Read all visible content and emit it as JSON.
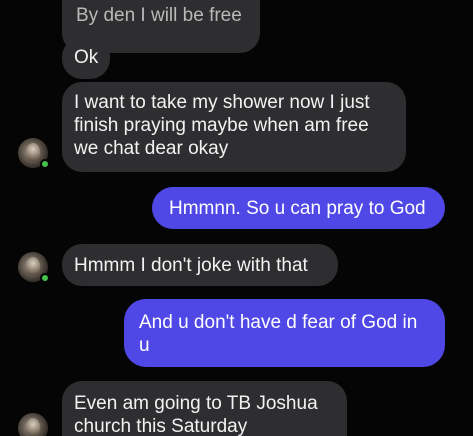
{
  "messages": [
    {
      "side": "received",
      "text": "By den I will be free"
    },
    {
      "side": "received",
      "text": "Ok"
    },
    {
      "side": "received",
      "text": "I want to take my shower now I just\nfinish praying maybe when am free\nwe chat dear okay"
    },
    {
      "side": "sent",
      "text": "Hmmnn. So u can pray to God"
    },
    {
      "side": "received",
      "text": "Hmmm I don't joke with that"
    },
    {
      "side": "sent",
      "text": "And u don't have d fear of God in\nu"
    },
    {
      "side": "received",
      "text": "Even am going to TB Joshua\nchurch this Saturday"
    }
  ],
  "colors": {
    "background": "#050505",
    "received_bubble": "#2e2e30",
    "sent_bubble": "#4f48e6",
    "online_dot": "#45c24b"
  },
  "icons": {
    "avatar": "contact-avatar",
    "status": "online-status-dot"
  }
}
